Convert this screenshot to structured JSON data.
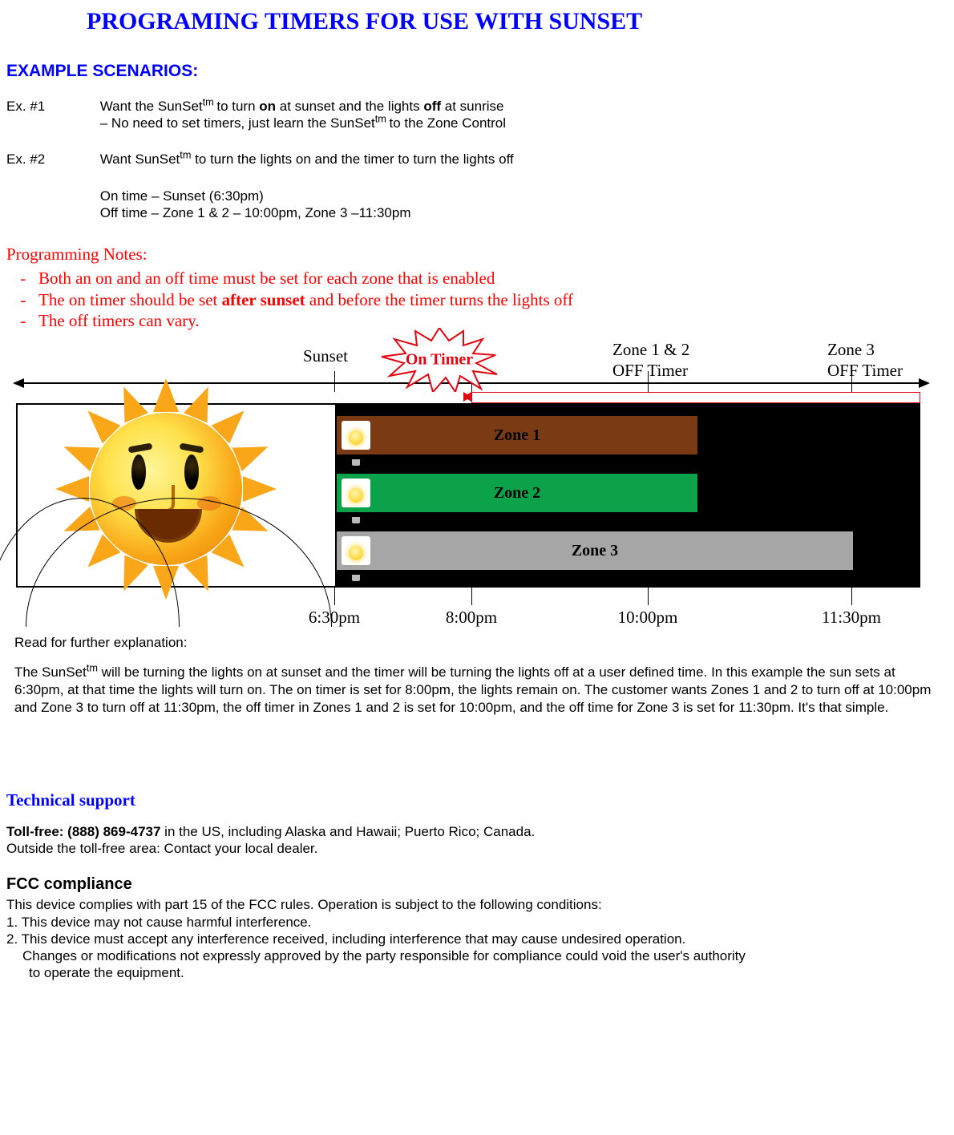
{
  "title": "PROGRAMING TIMERS FOR USE WITH SUNSET",
  "section_examples": "EXAMPLE SCENARIOS:",
  "ex1": {
    "label": "Ex. #1",
    "line1a": "Want the SunSet",
    "tm": "tm ",
    "line1b": "to turn ",
    "on": "on",
    "line1c": " at sunset and the lights ",
    "off": "off",
    "line1d": " at sunrise",
    "line2a": "– No need to set timers, just learn the SunSet",
    "line2b": " to the Zone Control"
  },
  "ex2": {
    "label": "Ex. #2",
    "line1a": "Want SunSet",
    "tm": "tm",
    "line1b": " to turn the lights on and the timer to turn the lights off",
    "on_time": "On time – Sunset (6:30pm)",
    "off_time": "Off time – Zone 1 & 2 – 10:00pm, Zone 3 –11:30pm"
  },
  "notes": {
    "heading": "Programming Notes:",
    "i1": "Both an on and an off time must be set for each zone that is enabled",
    "i2a": "The on timer should be set ",
    "i2b": "after sunset",
    "i2c": " and before the timer turns the lights off",
    "i3": "The off timers can vary."
  },
  "diagram": {
    "sunset": "Sunset",
    "on_timer": "On Timer",
    "z12_a": "Zone 1 & 2",
    "z12_b": "OFF Timer",
    "z3_a": "Zone 3",
    "z3_b": "OFF Timer",
    "zone1": "Zone 1",
    "zone2": "Zone 2",
    "zone3": "Zone 3",
    "t1": "6:30pm",
    "t2": "8:00pm",
    "t3": "10:00pm",
    "t4": "11:30pm"
  },
  "explain": {
    "hdr": "Read for further explanation:",
    "p1a": "The SunSet",
    "tm": "tm",
    "p1b": " will be turning the lights on at sunset and the timer will be turning the lights off at a user defined time. In this example the sun sets at 6:30pm, at that time the lights will turn on. The on timer is set for 8:00pm, the lights remain on. The customer wants Zones 1 and 2 to turn off at 10:00pm and Zone 3 to turn off at 11:30pm, the off timer in Zones 1 and 2 is set for 10:00pm, and the off time for Zone 3 is set for 11:30pm. It's that simple."
  },
  "tech": {
    "hdr": "Technical support",
    "phone_label": "Toll-free: (888) 869-4737",
    "phone_rest": " in the US, including Alaska and Hawaii; Puerto Rico; Canada.",
    "outside": "Outside the toll-free area: Contact your local dealer."
  },
  "fcc": {
    "hdr": "FCC compliance",
    "l0": "This device complies with part 15 of the FCC rules. Operation is subject to the following conditions:",
    "l1": "1. This device may not cause harmful interference.",
    "l2": "2. This device must accept any interference received, including interference that may cause undesired operation.",
    "l3": "Changes or modifications not expressly approved by the party responsible for compliance could void the user's authority",
    "l4": " to operate the equipment."
  },
  "chart_data": {
    "type": "bar",
    "x_axis": [
      "6:30pm",
      "8:00pm",
      "10:00pm",
      "11:30pm"
    ],
    "events": {
      "Sunset": "6:30pm",
      "On Timer": "8:00pm",
      "Zone 1 & 2 OFF Timer": "10:00pm",
      "Zone 3 OFF Timer": "11:30pm"
    },
    "series": [
      {
        "name": "Zone 1",
        "on": "6:30pm",
        "off": "10:00pm",
        "color": "#7A3B14"
      },
      {
        "name": "Zone 2",
        "on": "6:30pm",
        "off": "10:00pm",
        "color": "#0BA24A"
      },
      {
        "name": "Zone 3",
        "on": "6:30pm",
        "off": "11:30pm",
        "color": "#A6A6A6"
      }
    ],
    "on_timer_valid_range": {
      "from": "8:00pm",
      "to": "11:30pm",
      "note": "must be after sunset and before off timer"
    }
  }
}
